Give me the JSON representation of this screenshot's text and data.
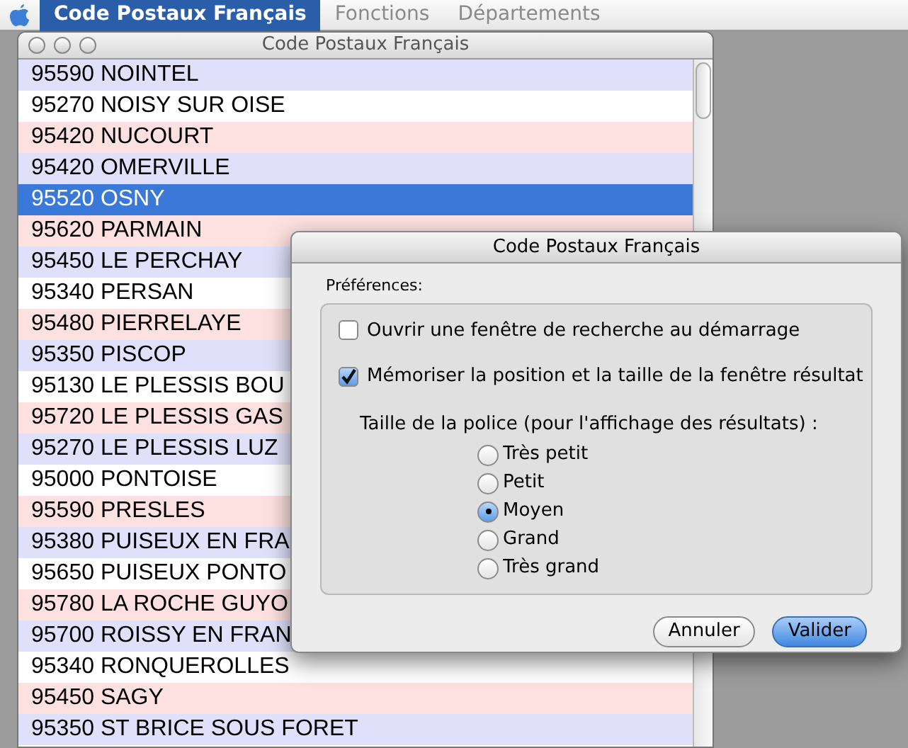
{
  "menu_bar": {
    "items": [
      {
        "label": "Code Postaux Français",
        "selected": true
      },
      {
        "label": "Fonctions",
        "selected": false
      },
      {
        "label": "Départements",
        "selected": false
      }
    ]
  },
  "list_window": {
    "title": "Code Postaux Français",
    "rows": [
      {
        "text": "95590 NOINTEL",
        "color": "#e0e0fa",
        "selected": false
      },
      {
        "text": "95270 NOISY SUR OISE",
        "color": "#ffffff",
        "selected": false
      },
      {
        "text": "95420 NUCOURT",
        "color": "#fde0e0",
        "selected": false
      },
      {
        "text": "95420 OMERVILLE",
        "color": "#e0e0fa",
        "selected": false
      },
      {
        "text": "95520 OSNY",
        "selected": true
      },
      {
        "text": "95620 PARMAIN",
        "color": "#fde0e0",
        "selected": false
      },
      {
        "text": "95450 LE PERCHAY",
        "color": "#e0e0fa",
        "selected": false
      },
      {
        "text": "95340 PERSAN",
        "color": "#ffffff",
        "selected": false
      },
      {
        "text": "95480 PIERRELAYE",
        "color": "#fde0e0",
        "selected": false
      },
      {
        "text": "95350 PISCOP",
        "color": "#e0e0fa",
        "selected": false
      },
      {
        "text": "95130 LE PLESSIS BOU",
        "color": "#ffffff",
        "selected": false
      },
      {
        "text": "95720 LE PLESSIS GAS",
        "color": "#fde0e0",
        "selected": false
      },
      {
        "text": "95270 LE PLESSIS LUZ",
        "color": "#e0e0fa",
        "selected": false
      },
      {
        "text": "95000 PONTOISE",
        "color": "#ffffff",
        "selected": false
      },
      {
        "text": "95590 PRESLES",
        "color": "#fde0e0",
        "selected": false
      },
      {
        "text": "95380 PUISEUX EN FRA",
        "color": "#e0e0fa",
        "selected": false
      },
      {
        "text": "95650 PUISEUX PONTO",
        "color": "#ffffff",
        "selected": false
      },
      {
        "text": "95780 LA ROCHE GUYO",
        "color": "#fde0e0",
        "selected": false
      },
      {
        "text": "95700 ROISSY EN FRAN",
        "color": "#e0e0fa",
        "selected": false
      },
      {
        "text": "95340 RONQUEROLLES",
        "color": "#ffffff",
        "selected": false
      },
      {
        "text": "95450 SAGY",
        "color": "#fde0e0",
        "selected": false
      },
      {
        "text": "95350 ST BRICE SOUS FORET",
        "color": "#e0e0fa",
        "selected": false
      }
    ]
  },
  "dialog": {
    "title": "Code Postaux Français",
    "section_label": "Préférences:",
    "checkboxes": [
      {
        "label": "Ouvrir une fenêtre de recherche au démarrage",
        "checked": false
      },
      {
        "label": "Mémoriser la position et la taille de la fenêtre résultat",
        "checked": true
      }
    ],
    "font_size_label": "Taille de la police (pour l'affichage des résultats) :",
    "font_sizes": [
      {
        "label": "Très petit",
        "selected": false
      },
      {
        "label": "Petit",
        "selected": false
      },
      {
        "label": "Moyen",
        "selected": true
      },
      {
        "label": "Grand",
        "selected": false
      },
      {
        "label": "Très grand",
        "selected": false
      }
    ],
    "buttons": [
      {
        "label": "Annuler",
        "kind": "cancel"
      },
      {
        "label": "Valider",
        "kind": "default"
      }
    ]
  }
}
